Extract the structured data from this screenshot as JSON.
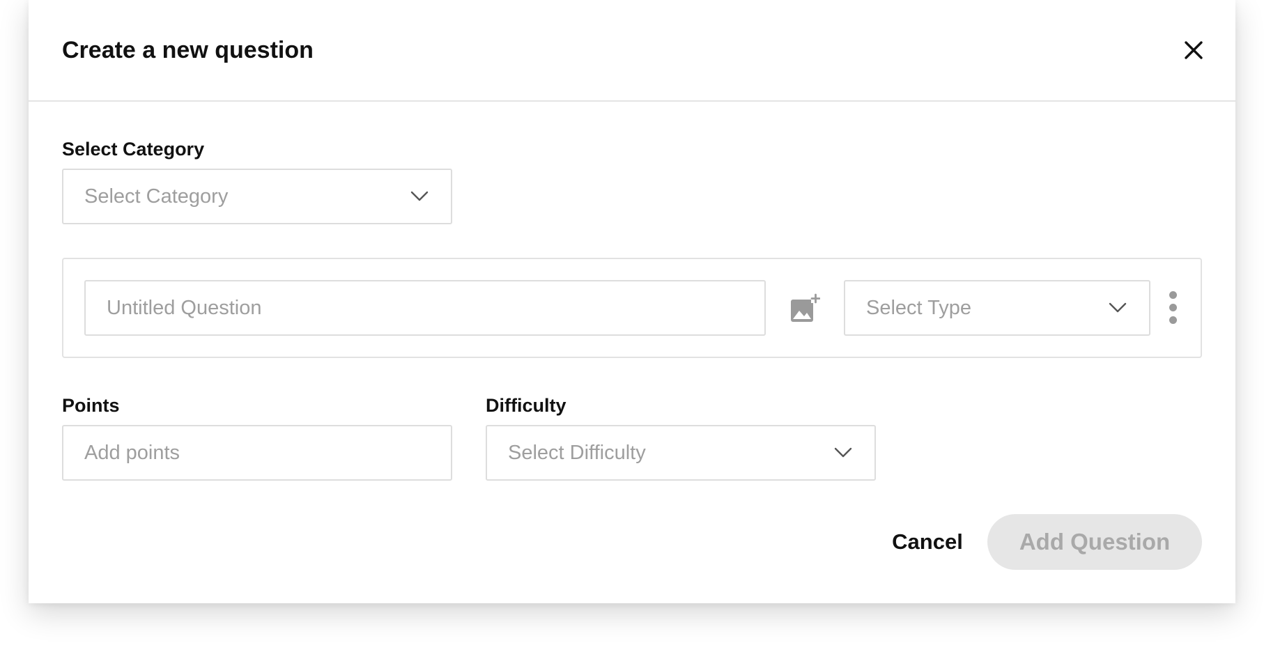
{
  "modal": {
    "title": "Create a new question",
    "close_icon": "close-icon"
  },
  "category": {
    "label": "Select Category",
    "placeholder": "Select Category",
    "chevron_icon": "chevron-down-icon"
  },
  "question": {
    "title_placeholder": "Untitled Question",
    "image_icon": "add-photo-icon",
    "type_placeholder": "Select Type",
    "type_chevron_icon": "chevron-down-icon",
    "more_icon": "more-vertical-icon"
  },
  "points": {
    "label": "Points",
    "placeholder": "Add points"
  },
  "difficulty": {
    "label": "Difficulty",
    "placeholder": "Select Difficulty",
    "chevron_icon": "chevron-down-icon"
  },
  "actions": {
    "cancel_label": "Cancel",
    "add_label": "Add Question",
    "add_disabled": true
  },
  "colors": {
    "text_primary": "#111111",
    "placeholder": "#9e9e9e",
    "border": "#dddddd",
    "disabled_button_bg": "#e6e6e6",
    "disabled_button_text": "#a9a9a9"
  }
}
